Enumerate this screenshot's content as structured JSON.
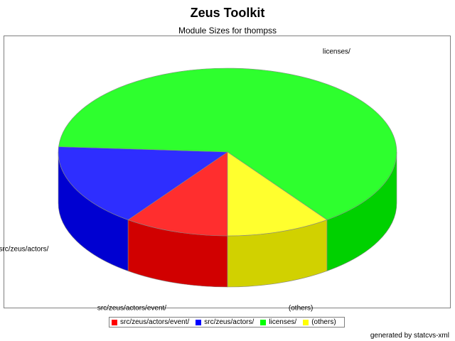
{
  "chart_data": {
    "type": "pie",
    "title": "Zeus Toolkit",
    "subtitle": "Module Sizes for thompss",
    "categories": [
      "src/zeus/actors/event/",
      "src/zeus/actors/",
      "licenses/",
      "(others)"
    ],
    "values": [
      10,
      16,
      64,
      10
    ],
    "colors": [
      "#ff0000",
      "#0000ff",
      "#00ff00",
      "#ffff00"
    ],
    "legend_position": "bottom",
    "three_d": true
  },
  "footer": {
    "text": "generated by statcvs-xml"
  }
}
